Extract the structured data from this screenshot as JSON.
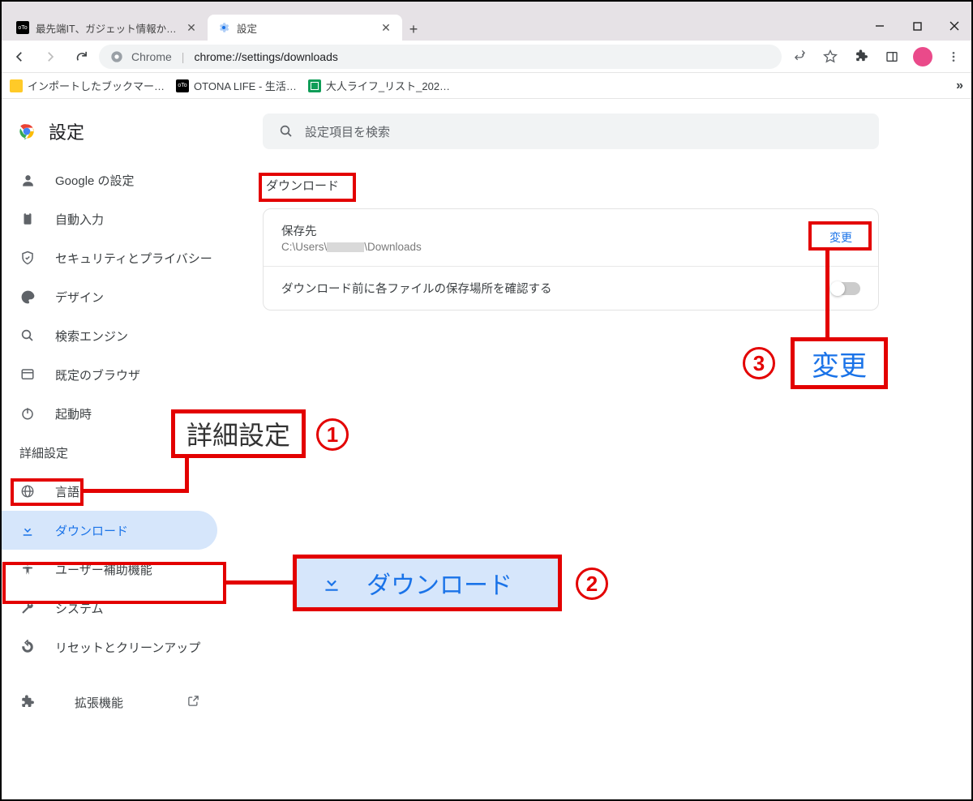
{
  "window": {
    "tabs": [
      {
        "title": "最先端IT、ガジェット情報からアナログ",
        "active": false
      },
      {
        "title": "設定",
        "active": true
      }
    ],
    "newtab": "+"
  },
  "toolbar": {
    "chrome_label": "Chrome",
    "url": "chrome://settings/downloads"
  },
  "bookmarks": {
    "items": [
      {
        "label": "インポートしたブックマー…",
        "icon": "folder"
      },
      {
        "label": "OTONA LIFE - 生活…",
        "icon": "oto"
      },
      {
        "label": "大人ライフ_リスト_202…",
        "icon": "sheets"
      }
    ],
    "more": "»"
  },
  "sidebar": {
    "title": "設定",
    "items": [
      {
        "icon": "person",
        "label": "Google の設定"
      },
      {
        "icon": "clipboard",
        "label": "自動入力"
      },
      {
        "icon": "shield",
        "label": "セキュリティとプライバシー"
      },
      {
        "icon": "palette",
        "label": "デザイン"
      },
      {
        "icon": "search",
        "label": "検索エンジン"
      },
      {
        "icon": "browser",
        "label": "既定のブラウザ"
      },
      {
        "icon": "power",
        "label": "起動時"
      }
    ],
    "advanced_label": "詳細設定",
    "advanced_items": [
      {
        "icon": "globe",
        "label": "言語"
      },
      {
        "icon": "download",
        "label": "ダウンロード",
        "selected": true
      },
      {
        "icon": "accessibility",
        "label": "ユーザー補助機能"
      },
      {
        "icon": "wrench",
        "label": "システム"
      },
      {
        "icon": "reset",
        "label": "リセットとクリーンアップ"
      }
    ],
    "extensions_label": "拡張機能"
  },
  "main": {
    "search_placeholder": "設定項目を検索",
    "section_title": "ダウンロード",
    "save_location_label": "保存先",
    "save_location_path_pre": "C:\\Users\\",
    "save_location_path_post": "\\Downloads",
    "change_button": "変更",
    "ask_before_label": "ダウンロード前に各ファイルの保存場所を確認する"
  },
  "annotations": {
    "callout1": "詳細設定",
    "callout2": "ダウンロード",
    "callout3": "変更",
    "n1": "1",
    "n2": "2",
    "n3": "3"
  }
}
